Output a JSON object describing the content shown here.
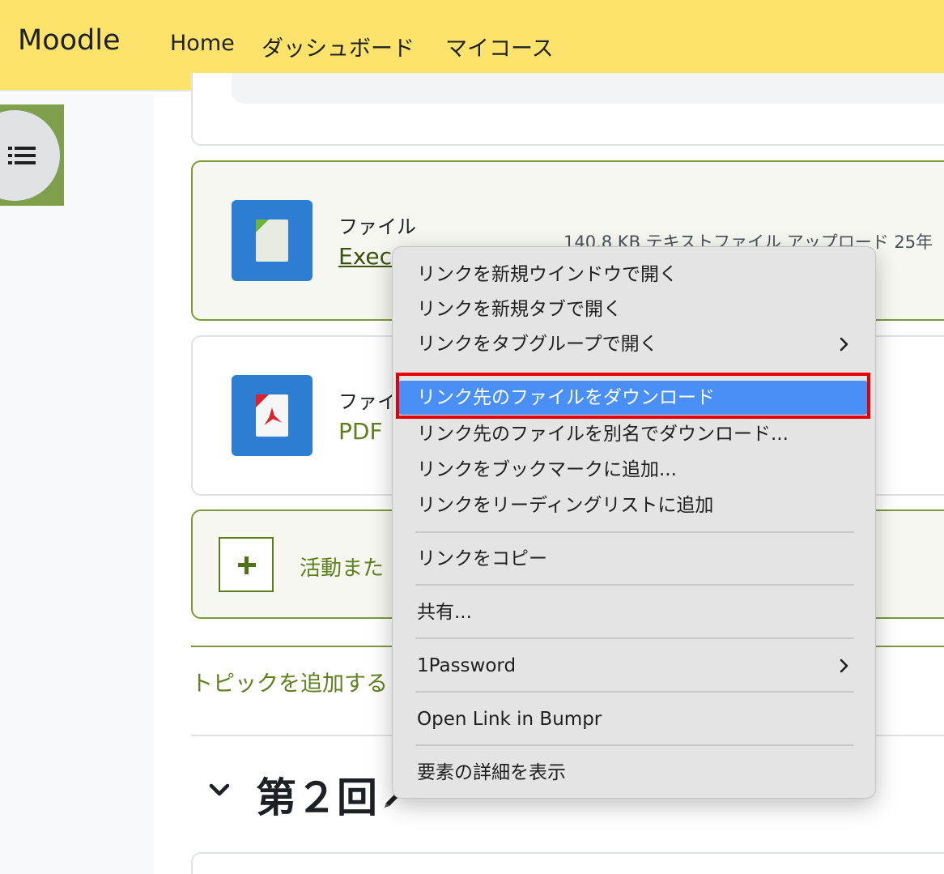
{
  "navbar": {
    "brand": "Moodle",
    "items": [
      "Home",
      "ダッシュボード",
      "マイコース"
    ]
  },
  "activities": [
    {
      "type": "ファイル",
      "name": "Exec",
      "meta": "140.8 KB テキストファイル アップロード 25年"
    },
    {
      "type": "ファイ",
      "name": "PDF"
    }
  ],
  "add_activity_label": "活動また",
  "add_topic_label": "トピックを追加する",
  "section_title": "第２回",
  "context_menu": {
    "items": [
      "リンクを新規ウインドウで開く",
      "リンクを新規タブで開く",
      "リンクをタブグループで開く",
      "リンク先のファイルをダウンロード",
      "リンク先のファイルを別名でダウンロード...",
      "リンクをブックマークに追加...",
      "リンクをリーディングリストに追加",
      "リンクをコピー",
      "共有...",
      "1Password",
      "Open Link in Bumpr",
      "要素の詳細を表示"
    ],
    "highlighted": "リンク先のファイルをダウンロード",
    "highlight_color": "#4a8ff6",
    "annotation_color": "#e60000"
  },
  "colors": {
    "navbar": "#fde36b",
    "accent": "#5f7f1f",
    "icon_bg": "#2d7dd2"
  }
}
